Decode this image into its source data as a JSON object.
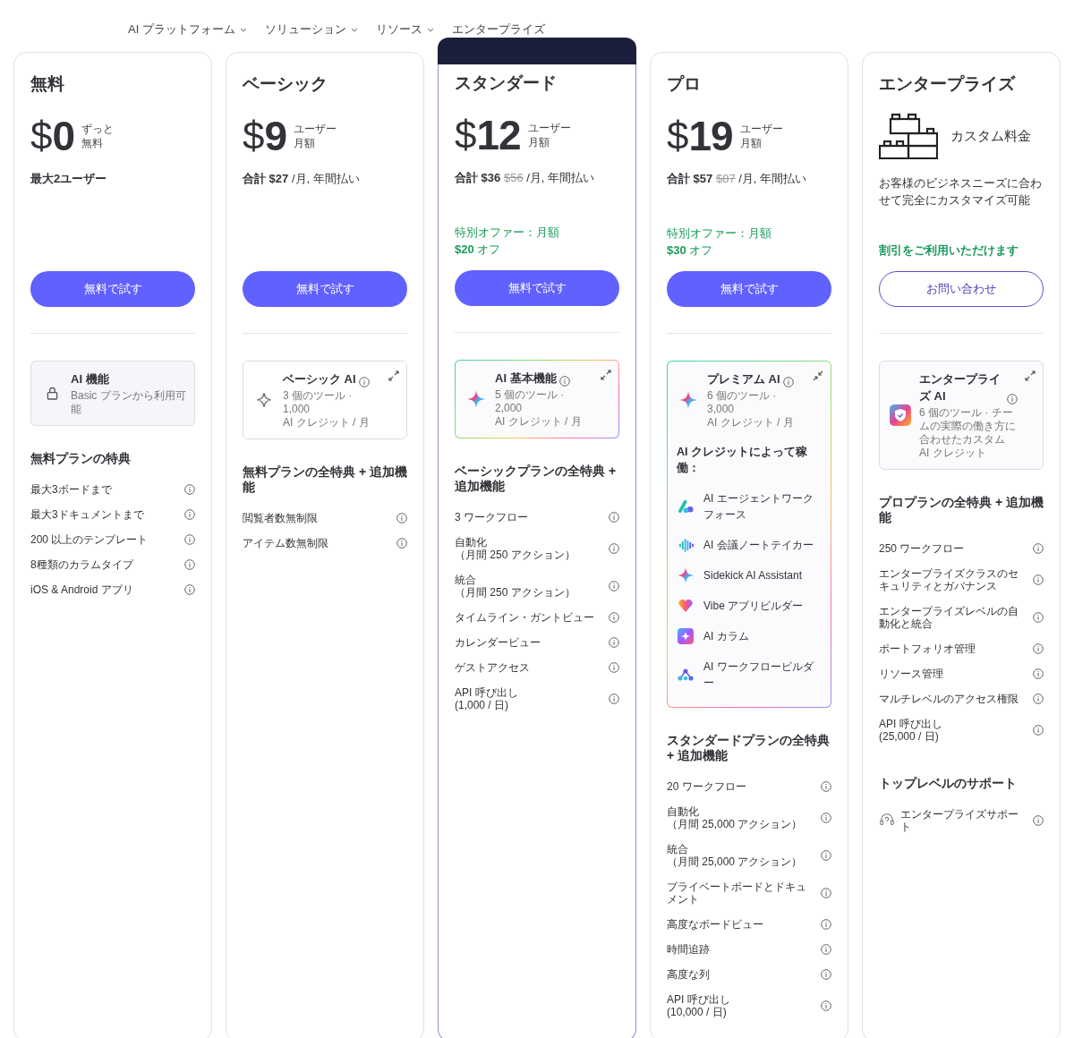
{
  "nav": [
    {
      "label": "AI プラットフォーム",
      "expandable": true
    },
    {
      "label": "ソリューション",
      "expandable": true
    },
    {
      "label": "リソース",
      "expandable": true
    },
    {
      "label": "エンタープライズ",
      "expandable": false
    }
  ],
  "plans": [
    {
      "name": "無料",
      "featured": false,
      "price": {
        "kind": "amount",
        "currency": "$",
        "amount": "0",
        "unit": [
          "ずっと",
          "無料"
        ]
      },
      "note": "最大2ユーザー",
      "button": {
        "label": "無料で試す",
        "kind": "primary"
      },
      "ai": {
        "kind": "locked",
        "title": "AI 機能",
        "description": "Basic プランから利用可能"
      },
      "sections": [
        {
          "title": "無料プランの特典",
          "items": [
            {
              "kind": "feature",
              "text": "最大3ボードまで"
            },
            {
              "kind": "feature",
              "text": "最大3ドキュメントまで"
            },
            {
              "kind": "feature",
              "text": "200 以上のテンプレート"
            },
            {
              "kind": "feature",
              "text": "8種類のカラムタイプ"
            },
            {
              "kind": "feature",
              "text": "iOS & Android アプリ"
            }
          ]
        }
      ]
    },
    {
      "name": "ベーシック",
      "featured": false,
      "price": {
        "kind": "amount",
        "currency": "$",
        "amount": "9",
        "unit": [
          "ユーザー",
          "月額"
        ]
      },
      "total": {
        "label": "合計 $27",
        "suffix": "/月, 年間払い"
      },
      "button": {
        "label": "無料で試す",
        "kind": "primary"
      },
      "ai": {
        "kind": "basic",
        "title": "ベーシック AI",
        "expanded": false,
        "description": "3 個のツール · 1,000\nAI クレジット / 月"
      },
      "sections": [
        {
          "title": "無料プランの全特典 + 追加機能",
          "items": [
            {
              "kind": "feature",
              "text": "閲覧者数無制限"
            },
            {
              "kind": "feature",
              "text": "アイテム数無制限"
            }
          ]
        }
      ]
    },
    {
      "name": "スタンダード",
      "featured": true,
      "price": {
        "kind": "amount",
        "currency": "$",
        "amount": "12",
        "unit": [
          "ユーザー",
          "月額"
        ]
      },
      "total": {
        "label": "合計 $36",
        "old": "$56",
        "suffix": "/月, 年間払い"
      },
      "offer": {
        "kind": "deal",
        "text": "特別オファー：月額",
        "amount": "**$20** オフ"
      },
      "button": {
        "label": "無料で試す",
        "kind": "primary"
      },
      "ai": {
        "kind": "gradient",
        "title": "AI 基本機能",
        "expanded": false,
        "description": "5 個のツール · 2,000\nAI クレジット / 月"
      },
      "sections": [
        {
          "title": "ベーシックプランの全特典 + 追加機能",
          "items": [
            {
              "kind": "feature",
              "text": "3 ワークフロー"
            },
            {
              "kind": "feature",
              "text": "自動化",
              "detail": "（月間 250 アクション）"
            },
            {
              "kind": "feature",
              "text": "統合",
              "detail": "（月間 250 アクション）"
            },
            {
              "kind": "feature",
              "text": "タイムライン・ガントビュー"
            },
            {
              "kind": "feature",
              "text": "カレンダービュー"
            },
            {
              "kind": "feature",
              "text": "ゲストアクセス"
            },
            {
              "kind": "feature",
              "text": "API 呼び出し",
              "detail": "(1,000 / 日)"
            }
          ]
        }
      ]
    },
    {
      "name": "プロ",
      "featured": false,
      "price": {
        "kind": "amount",
        "currency": "$",
        "amount": "19",
        "unit": [
          "ユーザー",
          "月額"
        ]
      },
      "total": {
        "label": "合計 $57",
        "old": "$87",
        "suffix": "/月, 年間払い"
      },
      "offer": {
        "kind": "deal",
        "text": "特別オファー：月額",
        "amount": "**$30** オフ"
      },
      "button": {
        "label": "無料で試す",
        "kind": "primary"
      },
      "ai": {
        "kind": "gradient",
        "title": "プレミアム AI",
        "expanded": true,
        "description": "6 個のツール · 3,000\nAI クレジット / 月",
        "tools_title": "AI クレジットによって稼働：",
        "tools": [
          {
            "kind": "agents",
            "label": "AI エージェントワークフォース"
          },
          {
            "kind": "notetaker",
            "label": "AI 会議ノートテイカー"
          },
          {
            "kind": "sidekick",
            "label": "Sidekick AI Assistant"
          },
          {
            "kind": "vibe",
            "label": "Vibe アプリビルダー"
          },
          {
            "kind": "column",
            "label": "AI カラム"
          },
          {
            "kind": "workflow",
            "label": "AI ワークフロービルダー"
          }
        ]
      },
      "sections": [
        {
          "title": "スタンダードプランの全特典 + 追加機能",
          "items": [
            {
              "kind": "feature",
              "text": "20 ワークフロー"
            },
            {
              "kind": "feature",
              "text": "自動化",
              "detail": "（月間 25,000 アクション）"
            },
            {
              "kind": "feature",
              "text": "統合",
              "detail": "（月間 25,000 アクション）"
            },
            {
              "kind": "feature",
              "text": "プライベートボードとドキュメント"
            },
            {
              "kind": "feature",
              "text": "高度なボードビュー"
            },
            {
              "kind": "feature",
              "text": "時間追跡"
            },
            {
              "kind": "feature",
              "text": "高度な列"
            },
            {
              "kind": "feature",
              "text": "API 呼び出し",
              "detail": "(10,000 / 日)"
            }
          ]
        }
      ]
    },
    {
      "name": "エンタープライズ",
      "featured": false,
      "price": {
        "kind": "custom",
        "label": "カスタム料金"
      },
      "description": "お客様のビジネスニーズに合わせて完全にカスタマイズ可能",
      "offer": {
        "kind": "note",
        "text": "割引をご利用いただけます"
      },
      "button": {
        "label": "お問い合わせ",
        "kind": "outline"
      },
      "ai": {
        "kind": "enterprise",
        "title": "エンタープライズ AI",
        "expanded": false,
        "description": "6 個のツール · チームの実際の働き方に合わせたカスタム AI クレジット"
      },
      "sections": [
        {
          "title": "プロプランの全特典 + 追加機能",
          "items": [
            {
              "kind": "feature",
              "text": "250 ワークフロー"
            },
            {
              "kind": "feature",
              "text": "エンタープライズクラスのセキュリティとガバナンス"
            },
            {
              "kind": "feature",
              "text": "エンタープライズレベルの自動化と統合"
            },
            {
              "kind": "feature",
              "text": "ポートフォリオ管理"
            },
            {
              "kind": "feature",
              "text": "リソース管理"
            },
            {
              "kind": "feature",
              "text": "マルチレベルのアクセス権限"
            },
            {
              "kind": "feature",
              "text": "API 呼び出し",
              "detail": "(25,000 / 日)"
            }
          ]
        },
        {
          "title": "トップレベルのサポート",
          "items": [
            {
              "kind": "support",
              "text": "エンタープライズサポート"
            }
          ]
        }
      ]
    }
  ]
}
